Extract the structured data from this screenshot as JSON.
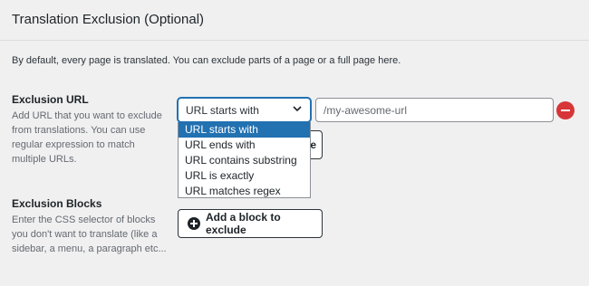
{
  "section": {
    "title": "Translation Exclusion (Optional)",
    "intro": "By default, every page is translated. You can exclude parts of a page or a full page here."
  },
  "exclusion_url": {
    "label": "Exclusion URL",
    "description": "Add URL that you want to exclude from translations. You can use regular expression to match multiple URLs.",
    "match_type": {
      "selected": "URL starts with",
      "options": [
        "URL starts with",
        "URL ends with",
        "URL contains substring",
        "URL is exactly",
        "URL matches regex"
      ]
    },
    "url_value": "/my-awesome-url",
    "partially_hidden_button_text": "e"
  },
  "exclusion_blocks": {
    "label": "Exclusion Blocks",
    "description": "Enter the CSS selector of blocks you don't want to translate (like a sidebar, a menu, a paragraph etc...",
    "add_button_label": "Add a block to exclude"
  },
  "icons": {
    "chevron": "chevron-down-icon",
    "remove": "remove-circle-icon",
    "add": "plus-circle-icon"
  },
  "colors": {
    "accent": "#2271b1",
    "danger": "#d63638",
    "background": "#f0f0f1"
  }
}
